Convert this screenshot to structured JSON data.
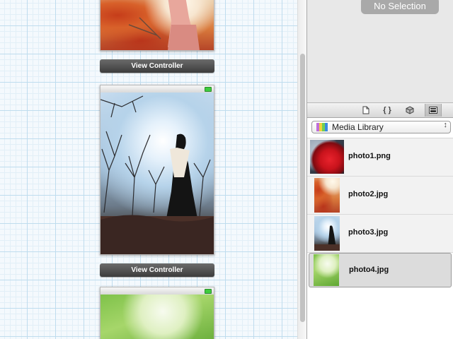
{
  "inspector": {
    "empty_label": "No Selection"
  },
  "canvas": {
    "scenes": [
      {
        "label": "View Controller"
      },
      {
        "label": "View Controller"
      }
    ]
  },
  "library": {
    "tabs": [
      "file-template-icon",
      "code-snippet-icon",
      "object-cube-icon",
      "media-icon"
    ],
    "active_tab": "media-icon",
    "selector": "Media Library",
    "items": [
      {
        "name": "photo1.png",
        "thumb": "red-rose"
      },
      {
        "name": "photo2.jpg",
        "thumb": "autumn-girl"
      },
      {
        "name": "photo3.jpg",
        "thumb": "winter-girl"
      },
      {
        "name": "photo4.jpg",
        "thumb": "green-park",
        "selected": true
      }
    ]
  },
  "colors": {
    "vc_bar": "#4a4a4a",
    "grid": "#bfdcee",
    "battery": "#3ecb3e"
  }
}
